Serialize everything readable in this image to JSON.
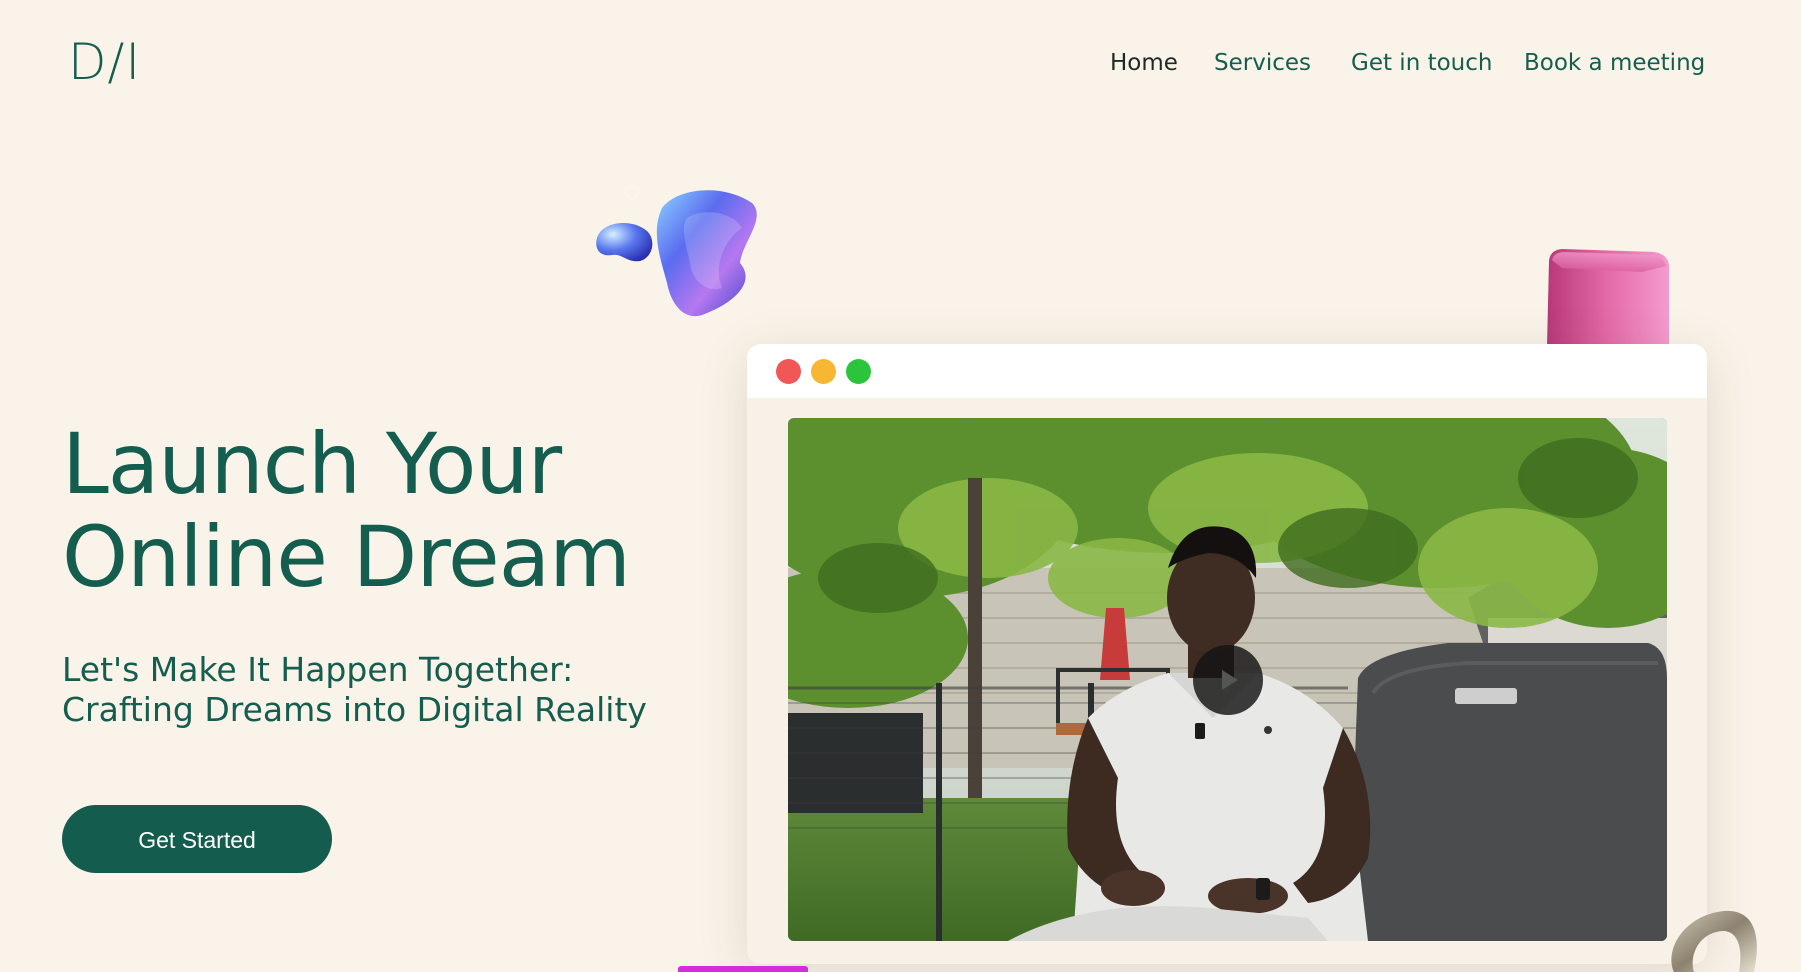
{
  "header": {
    "logo": "D/I",
    "nav": [
      {
        "label": "Home",
        "active": true
      },
      {
        "label": "Services",
        "active": false
      },
      {
        "label": "Get in touch",
        "active": false
      },
      {
        "label": "Book a meeting",
        "active": false
      }
    ]
  },
  "hero": {
    "title_line1": "Launch Your",
    "title_line2": "Online Dream",
    "subtitle_line1": "Let's Make It Happen Together:",
    "subtitle_line2": "Crafting Dreams into Digital Reality",
    "cta_label": "Get Started"
  },
  "browser_window": {
    "traffic_lights": [
      "#f25757",
      "#f7b733",
      "#2dc43d"
    ]
  },
  "colors": {
    "background": "#f9f3e9",
    "brand": "#155e4f",
    "accent_magenta": "#d52dde"
  },
  "icons": {
    "play": "play-icon"
  }
}
